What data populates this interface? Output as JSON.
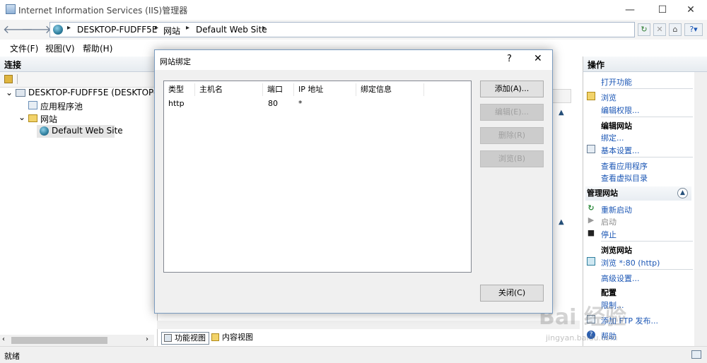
{
  "window": {
    "title": "Internet Information Services (IIS)管理器",
    "minimize": "—",
    "maximize": "☐",
    "close": "✕"
  },
  "address": {
    "back": "🡐",
    "forward": "🡒",
    "crumbs": [
      "DESKTOP-FUDFF5E",
      "网站",
      "Default Web Site"
    ],
    "separator": "▸",
    "dropdown": "▸"
  },
  "menu": [
    "文件(F)",
    "视图(V)",
    "帮助(H)"
  ],
  "connections": {
    "header": "连接",
    "server": "DESKTOP-FUDFF5E (DESKTOP-FUD",
    "app_pools": "应用程序池",
    "sites": "网站",
    "site": "Default Web Site"
  },
  "main": {
    "view_tabs": [
      "功能视图",
      "内容视图"
    ]
  },
  "actions": {
    "header": "操作",
    "open_feature": "打开功能",
    "explore": "浏览",
    "edit_permissions": "编辑权限...",
    "edit_site": "编辑网站",
    "bindings": "绑定...",
    "basic_settings": "基本设置...",
    "view_apps": "查看应用程序",
    "view_vdirs": "查看虚拟目录",
    "manage_site": "管理网站",
    "restart": "重新启动",
    "start": "启动",
    "stop": "停止",
    "browse_site": "浏览网站",
    "browse_http": "浏览 *:80 (http)",
    "advanced_settings": "高级设置...",
    "config": "配置",
    "limits": "限制...",
    "ftp": "添加 FTP 发布...",
    "help": "帮助"
  },
  "status": {
    "text": "就绪"
  },
  "dialog": {
    "title": "网站绑定",
    "help": "?",
    "close": "✕",
    "columns": [
      "类型",
      "主机名",
      "端口",
      "IP 地址",
      "绑定信息"
    ],
    "rows": [
      {
        "type": "http",
        "host": "",
        "port": "80",
        "ip": "*",
        "info": ""
      }
    ],
    "buttons": {
      "add": "添加(A)...",
      "edit": "编辑(E)...",
      "remove": "删除(R)",
      "browse": "浏览(B)",
      "close": "关闭(C)"
    }
  },
  "watermark": {
    "logo": "Bai 经验",
    "url": "jingyan.baidu.com"
  }
}
